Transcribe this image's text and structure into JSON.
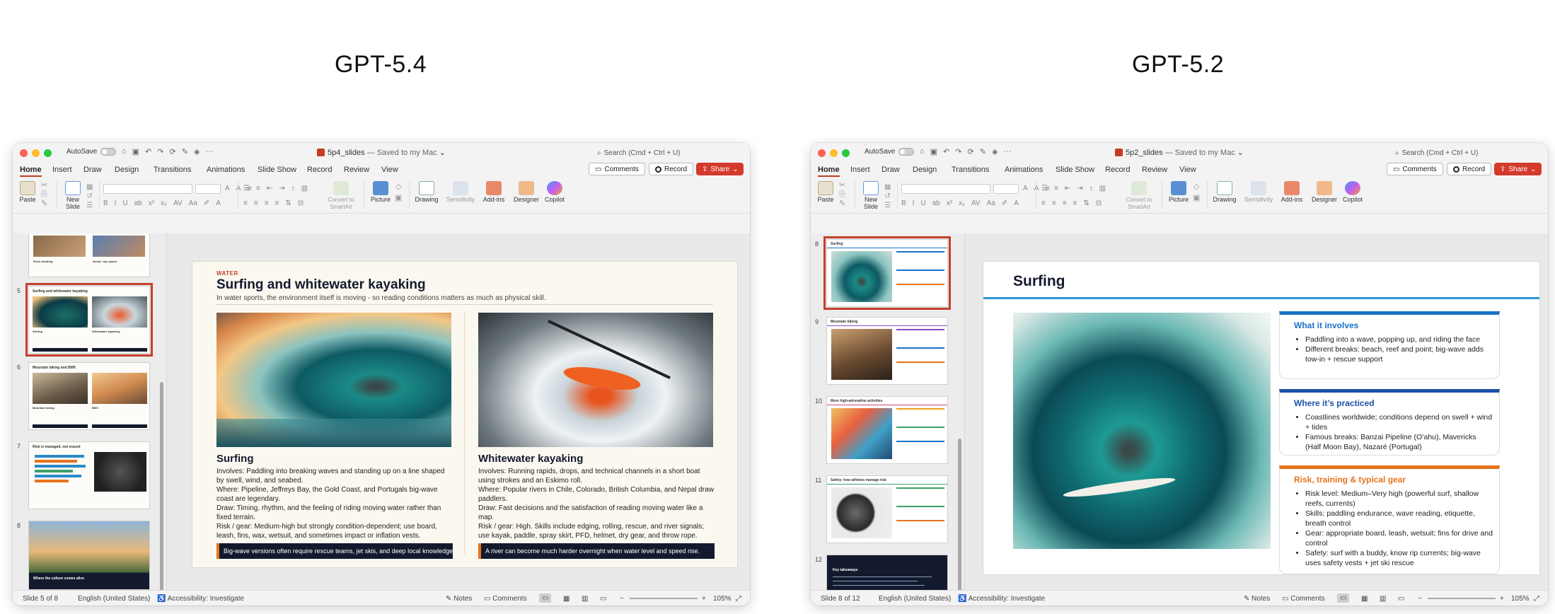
{
  "headings": {
    "left": "GPT-5.4",
    "right": "GPT-5.2"
  },
  "left": {
    "autosave": "AutoSave",
    "doc_name": "5p4_slides",
    "doc_status": "— Saved to my Mac",
    "search": "Search (Cmd + Ctrl + U)",
    "tabs": [
      "Home",
      "Insert",
      "Draw",
      "Design",
      "Transitions",
      "Animations",
      "Slide Show",
      "Record",
      "Review",
      "View"
    ],
    "comments_btn": "Comments",
    "record_btn": "Record",
    "share_btn": "Share",
    "ribbon": {
      "paste": "Paste",
      "new_slide": "New\nSlide",
      "convert": "Convert to\nSmartArt",
      "picture": "Picture",
      "drawing": "Drawing",
      "sensitivity": "Sensitivity",
      "addins": "Add-ins",
      "designer": "Designer",
      "copilot": "Copilot"
    },
    "thumbs": [
      {
        "num": "",
        "title": "Rock climbing",
        "title2": "Aerial / sky sports"
      },
      {
        "num": "5",
        "title": "Surfing and whitewater kayaking",
        "caption1": "Surfing",
        "caption2": "Whitewater kayaking"
      },
      {
        "num": "6",
        "title": "Mountain biking and BMX",
        "caption1": "Mountain biking",
        "caption2": "BMX"
      },
      {
        "num": "7",
        "title": "Risk is managed, not erased"
      },
      {
        "num": "8",
        "title": "Where the culture comes alive"
      }
    ],
    "slide": {
      "kicker": "WATER",
      "title": "Surfing and whitewater kayaking",
      "subtitle": "In water sports, the environment itself is moving - so reading conditions matters as much as physical skill.",
      "col1": {
        "heading": "Surfing",
        "body": "Involves: Paddling into breaking waves and standing up on a line shaped by swell, wind, and seabed.\nWhere: Pipeline, Jeffreys Bay, the Gold Coast, and Portugals big-wave coast are legendary.\nDraw: Timing, rhythm, and the feeling of riding moving water rather than fixed terrain.\nRisk / gear: Medium-high but strongly condition-dependent; use board, leash, fins, wax, wetsuit, and sometimes impact or inflation vests.",
        "banner": "Big-wave versions often require rescue teams, jet skis, and deep local knowledge."
      },
      "col2": {
        "heading": "Whitewater kayaking",
        "body": "Involves: Running rapids, drops, and technical channels in a short boat using strokes and an Eskimo roll.\nWhere: Popular rivers in Chile, Colorado, British Columbia, and Nepal draw paddlers.\nDraw: Fast decisions and the satisfaction of reading moving water like a map.\nRisk / gear: High. Skills include edging, rolling, rescue, and river signals; use kayak, paddle, spray skirt, PFD, helmet, dry gear, and throw rope.",
        "banner": "A river can become much harder overnight when water level and speed rise."
      }
    },
    "status": {
      "slide": "Slide 5 of 8",
      "lang": "English (United States)",
      "access": "Accessibility: Investigate",
      "notes": "Notes",
      "comments": "Comments",
      "zoom": "105%"
    }
  },
  "right": {
    "autosave": "AutoSave",
    "doc_name": "5p2_slides",
    "doc_status": "— Saved to my Mac",
    "search": "Search (Cmd + Ctrl + U)",
    "tabs": [
      "Home",
      "Insert",
      "Draw",
      "Design",
      "Transitions",
      "Animations",
      "Slide Show",
      "Record",
      "Review",
      "View"
    ],
    "comments_btn": "Comments",
    "record_btn": "Record",
    "share_btn": "Share",
    "ribbon": {
      "paste": "Paste",
      "new_slide": "New\nSlide",
      "convert": "Convert to\nSmartArt",
      "picture": "Picture",
      "drawing": "Drawing",
      "sensitivity": "Sensitivity",
      "addins": "Add-ins",
      "designer": "Designer",
      "copilot": "Copilot"
    },
    "thumbs": [
      {
        "num": "8",
        "title": "Surfing"
      },
      {
        "num": "9",
        "title": "Mountain biking"
      },
      {
        "num": "10",
        "title": "More high-adrenaline activities"
      },
      {
        "num": "11",
        "title": "Safety: how athletes manage risk"
      },
      {
        "num": "12",
        "title": "Key takeaways"
      }
    ],
    "slide": {
      "title": "Surfing",
      "box1": {
        "heading": "What it involves",
        "bullets": [
          "Paddling into a wave, popping up, and riding the face",
          "Different breaks: beach, reef and point; big-wave adds tow-in + rescue support"
        ]
      },
      "box2": {
        "heading": "Where it’s practiced",
        "bullets": [
          "Coastlines worldwide; conditions depend on swell + wind + tides",
          "Famous breaks: Banzai Pipeline (O‘ahu), Mavericks (Half Moon Bay), Nazaré (Portugal)"
        ]
      },
      "box3": {
        "heading": "Risk, training & typical gear",
        "bullets": [
          "Risk level: Medium–Very high (powerful surf, shallow reefs, currents)",
          "Skills: paddling endurance, wave reading, etiquette, breath control",
          "Gear: appropriate board, leash, wetsuit; fins for drive and control",
          "Safety: surf with a buddy, know rip currents; big-wave uses safety vests + jet ski rescue"
        ]
      }
    },
    "status": {
      "slide": "Slide 8 of 12",
      "lang": "English (United States)",
      "access": "Accessibility: Investigate",
      "notes": "Notes",
      "comments": "Comments",
      "zoom": "105%"
    }
  },
  "colors": {
    "accent": "#c43e1c",
    "share": "#d43a2c",
    "blue": "#1a73c8",
    "orange": "#e8731c",
    "navy": "#141a2e"
  }
}
